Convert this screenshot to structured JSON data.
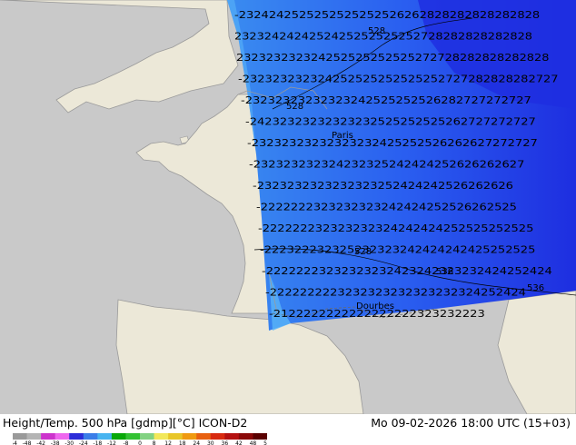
{
  "footer": {
    "title": "Height/Temp. 500 hPa [gdmp][°C] ICON-D2",
    "time": "Mo 09-02-2026 18:00 UTC (15+03)"
  },
  "legend": {
    "ticks": [
      "-54",
      "-48",
      "-42",
      "-38",
      "-30",
      "-24",
      "-18",
      "-12",
      "-8",
      "0",
      "8",
      "12",
      "18",
      "24",
      "30",
      "36",
      "42",
      "48",
      "54"
    ],
    "colors": [
      "#9a9a9a",
      "#b4b4b4",
      "#cc33cc",
      "#ee66ee",
      "#2c2cd8",
      "#3a7de8",
      "#48b4f0",
      "#08a808",
      "#33c233",
      "#82d282",
      "#f2e85a",
      "#e8c628",
      "#f09a10",
      "#e86010",
      "#d82a10",
      "#b41010",
      "#8a0808",
      "#5a0000"
    ]
  },
  "map": {
    "colors": {
      "sea": "#c9c9c9",
      "land": "#ece8d8",
      "border": "#9a9a9a",
      "field_light": "#3a8cf0",
      "field_mid": "#2a5ff0",
      "field_dark": "#1e2ee0",
      "field_edge": "#5ab4f8",
      "contour_text": "#000000"
    },
    "geopotential_labels": [
      "528",
      "528",
      "528",
      "536",
      "536"
    ],
    "places": [
      "Paris",
      "Dourbes"
    ],
    "rows": [
      "-2324242525252525252526262828282828282828",
      "2323242424252425252525252728282828282828",
      "232323232324252525252525272728282828282828",
      "-232323232324252525252525252727282828282727",
      "-23232323232323242525252526282727272727",
      "-24232323232323232525252525262727272727",
      "-23232323232323232425252526262627272727",
      "-232323232324232325242424252626262627",
      "-2323232323232323252424242526262626",
      "-2222222323232323242424252526262525",
      "-222222232323232324242424252525252525",
      "-222322232325232323242424242425252525",
      "-22222223232323232423242323232424252424",
      "-2222222223232323232323232324252424",
      "-2122222222222222222323232223"
    ]
  }
}
